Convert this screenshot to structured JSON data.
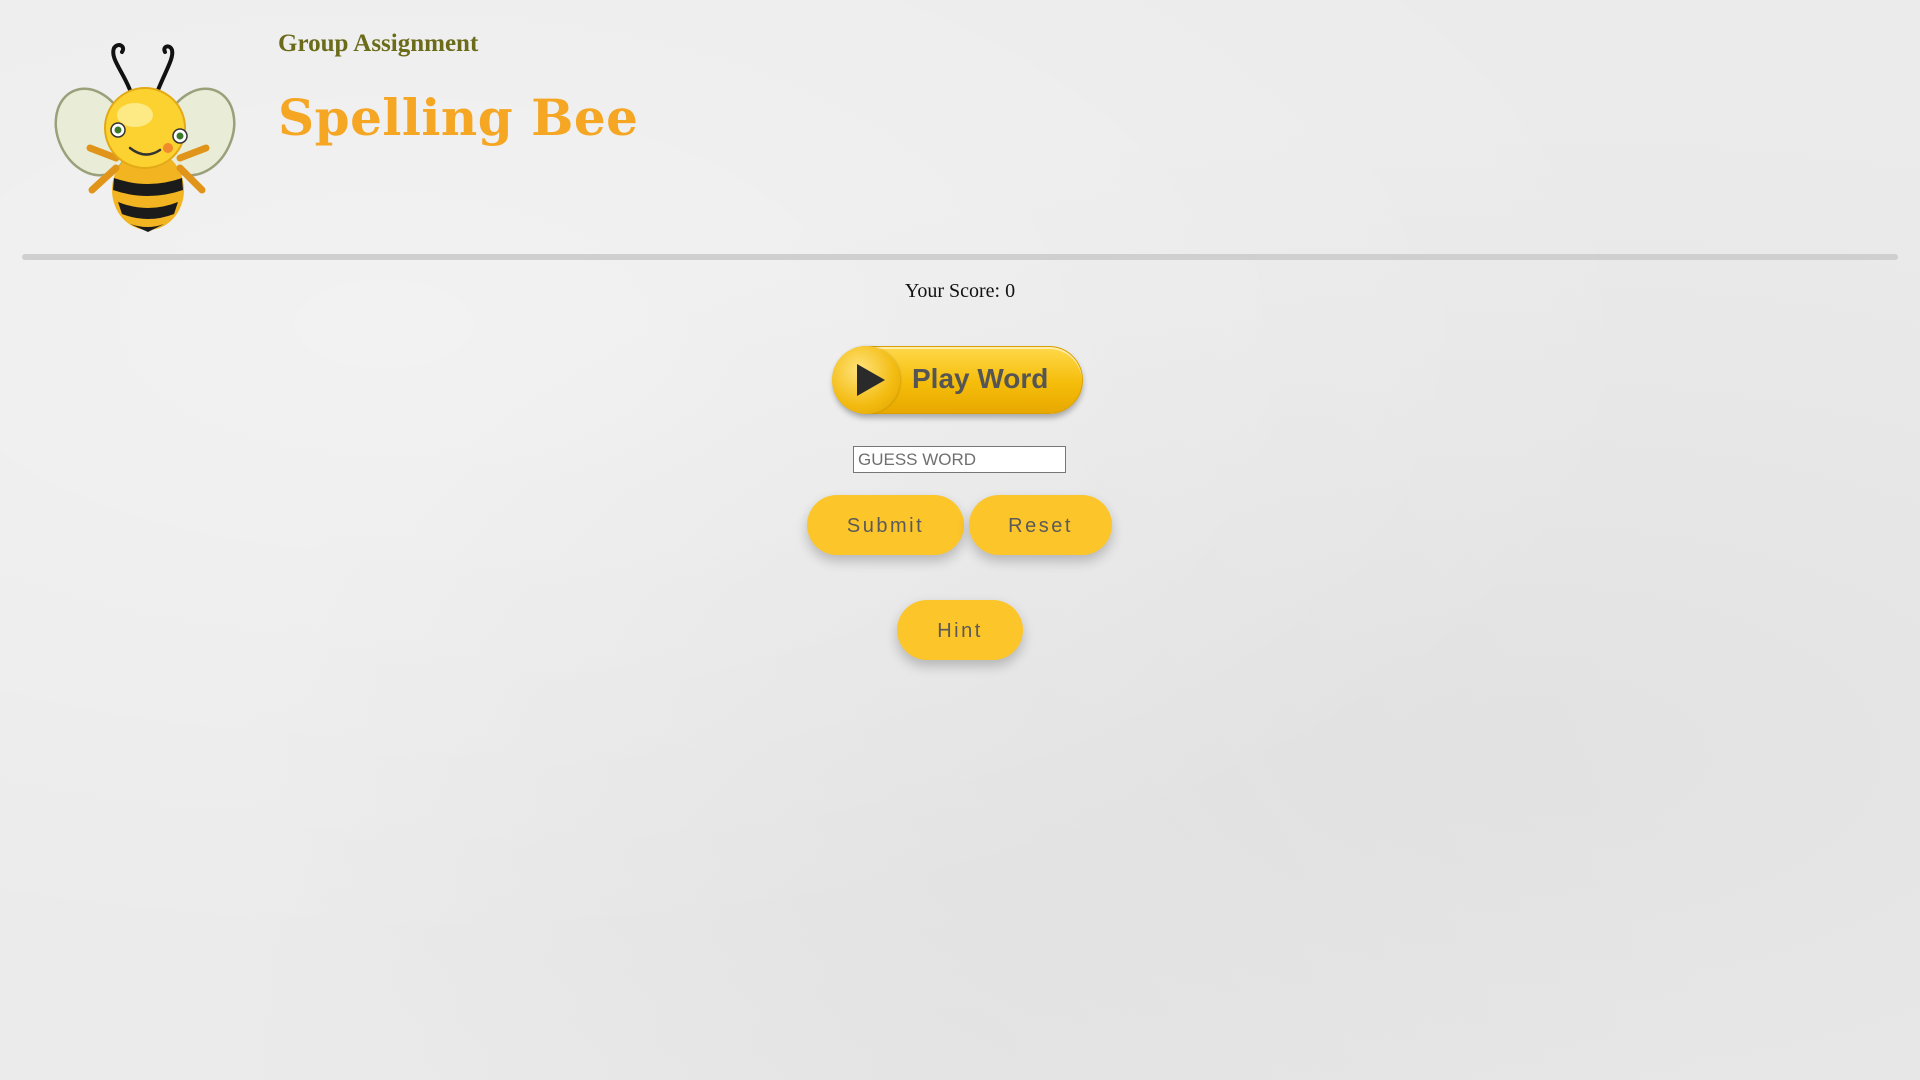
{
  "header": {
    "subtitle": "Group Assignment",
    "title": "Spelling Bee",
    "logo_icon": "bee-mascot-icon"
  },
  "score": {
    "text": "Your Score: 0"
  },
  "play_button": {
    "label": "Play Word",
    "icon": "play-triangle-icon"
  },
  "guess": {
    "placeholder": "GUESS WORD",
    "value": ""
  },
  "buttons": {
    "submit": "Submit",
    "reset": "Reset",
    "hint": "Hint"
  },
  "colors": {
    "accent": "#fcc52a",
    "title": "#f5a623",
    "subtitle": "#6b6b1a",
    "background": "#ebebeb"
  }
}
